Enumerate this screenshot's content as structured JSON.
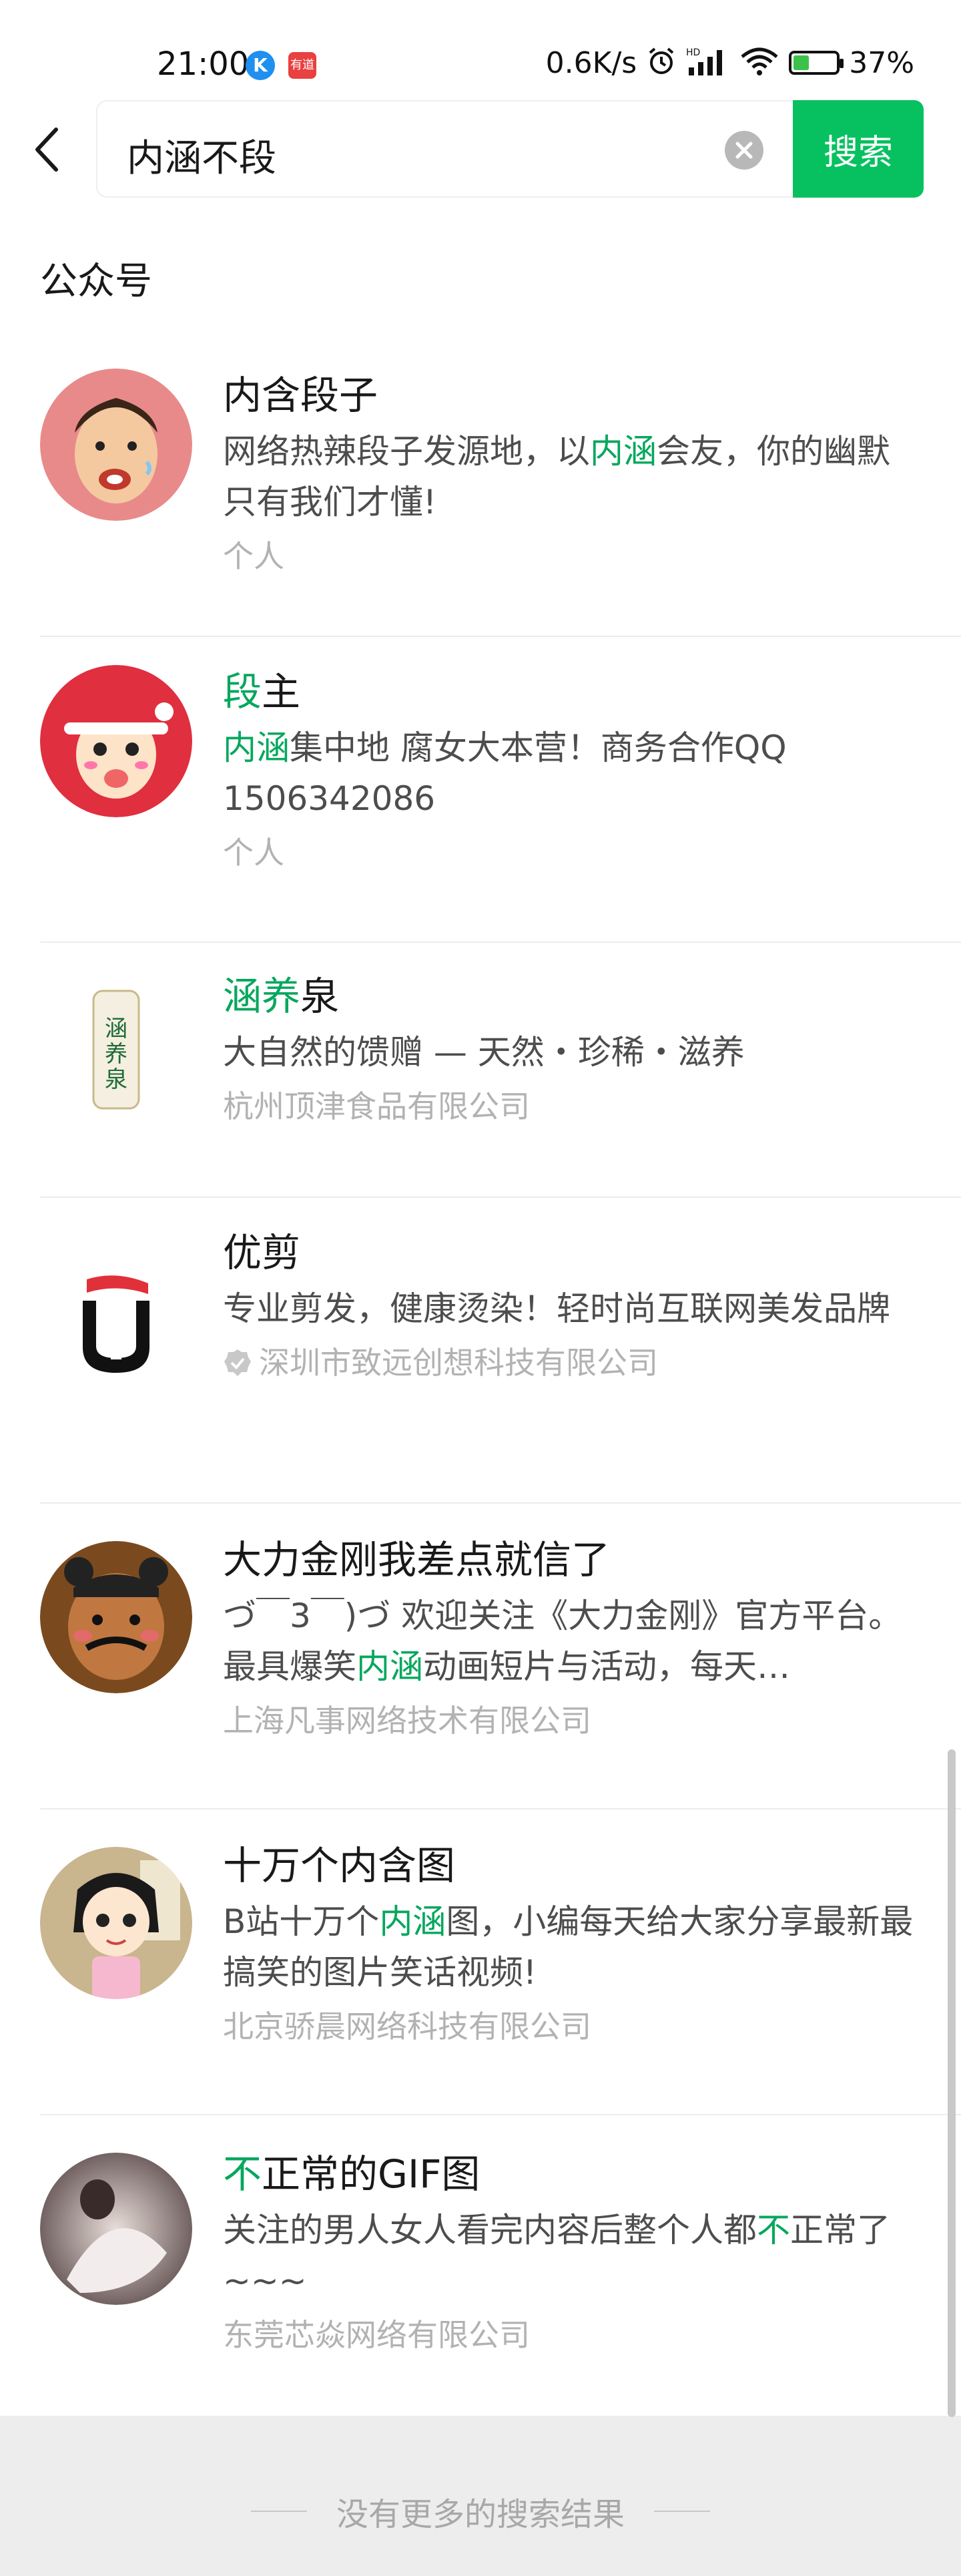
{
  "status_bar": {
    "time": "21:00",
    "app_icon_1_letter": "K",
    "app_icon_2_text": "有道",
    "net_speed": "0.6K/s",
    "battery_percent": "37%",
    "battery_level": 0.37
  },
  "search": {
    "query": "内涵不段",
    "button_label": "搜索"
  },
  "section": {
    "title": "公众号"
  },
  "results": [
    {
      "name_parts": [
        {
          "t": "内含段子",
          "h": false
        }
      ],
      "desc_parts": [
        {
          "t": "网络热辣段子发源地，以",
          "h": false
        },
        {
          "t": "内涵",
          "h": true
        },
        {
          "t": "会友，你的幽默只有我们才懂!",
          "h": false
        }
      ],
      "meta": "个人",
      "verified": false
    },
    {
      "name_parts": [
        {
          "t": "段",
          "h": true
        },
        {
          "t": "主",
          "h": false
        }
      ],
      "desc_parts": [
        {
          "t": "内涵",
          "h": true
        },
        {
          "t": "集中地 腐女大本营！商务合作QQ 1506342086",
          "h": false
        }
      ],
      "meta": "个人",
      "verified": false
    },
    {
      "name_parts": [
        {
          "t": "涵养",
          "h": true
        },
        {
          "t": "泉",
          "h": false
        }
      ],
      "desc_parts": [
        {
          "t": "大自然的馈赠 — 天然・珍稀・滋养",
          "h": false
        }
      ],
      "meta": "杭州顶津食品有限公司",
      "verified": false
    },
    {
      "name_parts": [
        {
          "t": "优剪",
          "h": false
        }
      ],
      "desc_parts": [
        {
          "t": "专业剪发，健康烫染！轻时尚互联网美发品牌",
          "h": false
        }
      ],
      "meta": "深圳市致远创想科技有限公司",
      "verified": true
    },
    {
      "name_parts": [
        {
          "t": "大力金刚我差点就信了",
          "h": false
        }
      ],
      "desc_parts": [
        {
          "t": "づ￣3￣)づ 欢迎关注《大力金刚》官方平台。最具爆笑",
          "h": false
        },
        {
          "t": "内涵",
          "h": true
        },
        {
          "t": "动画短片与活动，每天…",
          "h": false
        }
      ],
      "meta": "上海凡事网络技术有限公司",
      "verified": false
    },
    {
      "name_parts": [
        {
          "t": "十万个内含图",
          "h": false
        }
      ],
      "desc_parts": [
        {
          "t": "B站十万个",
          "h": false
        },
        {
          "t": "内涵",
          "h": true
        },
        {
          "t": "图，小编每天给大家分享最新最搞笑的图片笑话视频!",
          "h": false
        }
      ],
      "meta": "北京骄晨网络科技有限公司",
      "verified": false
    },
    {
      "name_parts": [
        {
          "t": "不",
          "h": true
        },
        {
          "t": "正常的GIF图",
          "h": false
        }
      ],
      "desc_parts": [
        {
          "t": "关注的男人女人看完内容后整个人都",
          "h": false
        },
        {
          "t": "不",
          "h": true
        },
        {
          "t": "正常了~~~",
          "h": false
        }
      ],
      "meta": "东莞芯焱网络有限公司",
      "verified": false
    }
  ],
  "footer": {
    "text": "没有更多的搜索结果"
  },
  "colors": {
    "accent": "#07c160",
    "highlight": "#07a75e"
  }
}
